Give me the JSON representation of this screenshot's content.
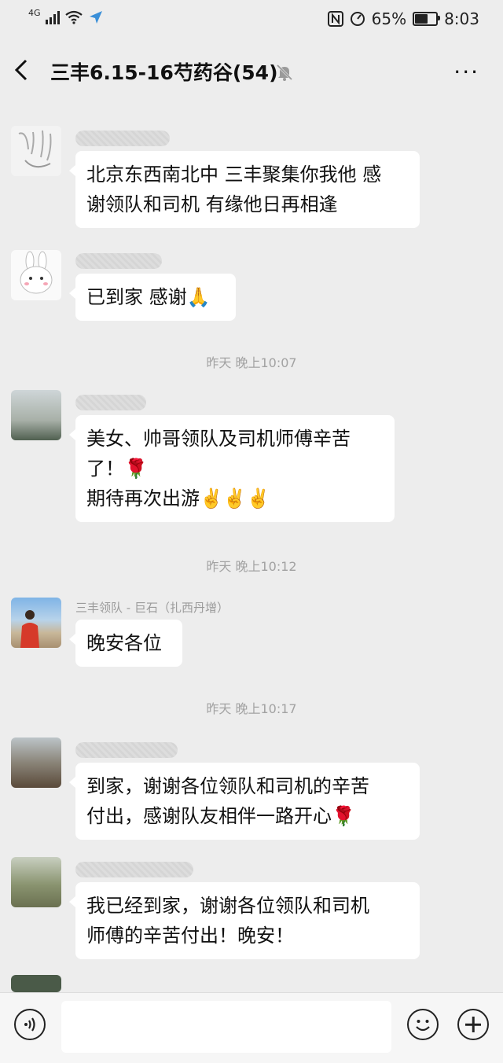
{
  "status_bar": {
    "network": "4G",
    "battery_percent": "65%",
    "battery_level": 0.65,
    "time": "8:03"
  },
  "nav": {
    "back_icon": "chevron-left",
    "title": "三丰6.15-16芍药谷(54)",
    "mute_icon": "bell-off",
    "more_icon": "more-dots",
    "more_label": "···"
  },
  "messages": [
    {
      "text_lines": [
        "北京东西南北中 三丰聚集你我他 感",
        "谢领队和司机 有缘他日再相逢"
      ]
    },
    {
      "text_lines": [
        "已到家 感谢🙏"
      ]
    },
    {
      "time": "昨天 晚上10:07"
    },
    {
      "text_lines": [
        "美女、帅哥领队及司机师傅辛苦",
        "了！🌹",
        "期待再次出游✌️✌️✌️"
      ]
    },
    {
      "time": "昨天 晚上10:12"
    },
    {
      "sender": "三丰领队 - 巨石（扎西丹增）",
      "text_lines": [
        "晚安各位"
      ]
    },
    {
      "time": "昨天 晚上10:17"
    },
    {
      "text_lines": [
        "到家，谢谢各位领队和司机的辛苦",
        "付出，感谢队友相伴一路开心🌹"
      ]
    },
    {
      "text_lines": [
        "我已经到家，谢谢各位领队和司机",
        "师傅的辛苦付出！晚安！"
      ]
    }
  ],
  "input_bar": {
    "voice_icon": "voice-icon",
    "emoji_icon": "smiley-icon",
    "plus_icon": "plus-icon"
  },
  "colors": {
    "background": "#ededed",
    "bubble": "#ffffff",
    "time_text": "#a2a2a2"
  }
}
